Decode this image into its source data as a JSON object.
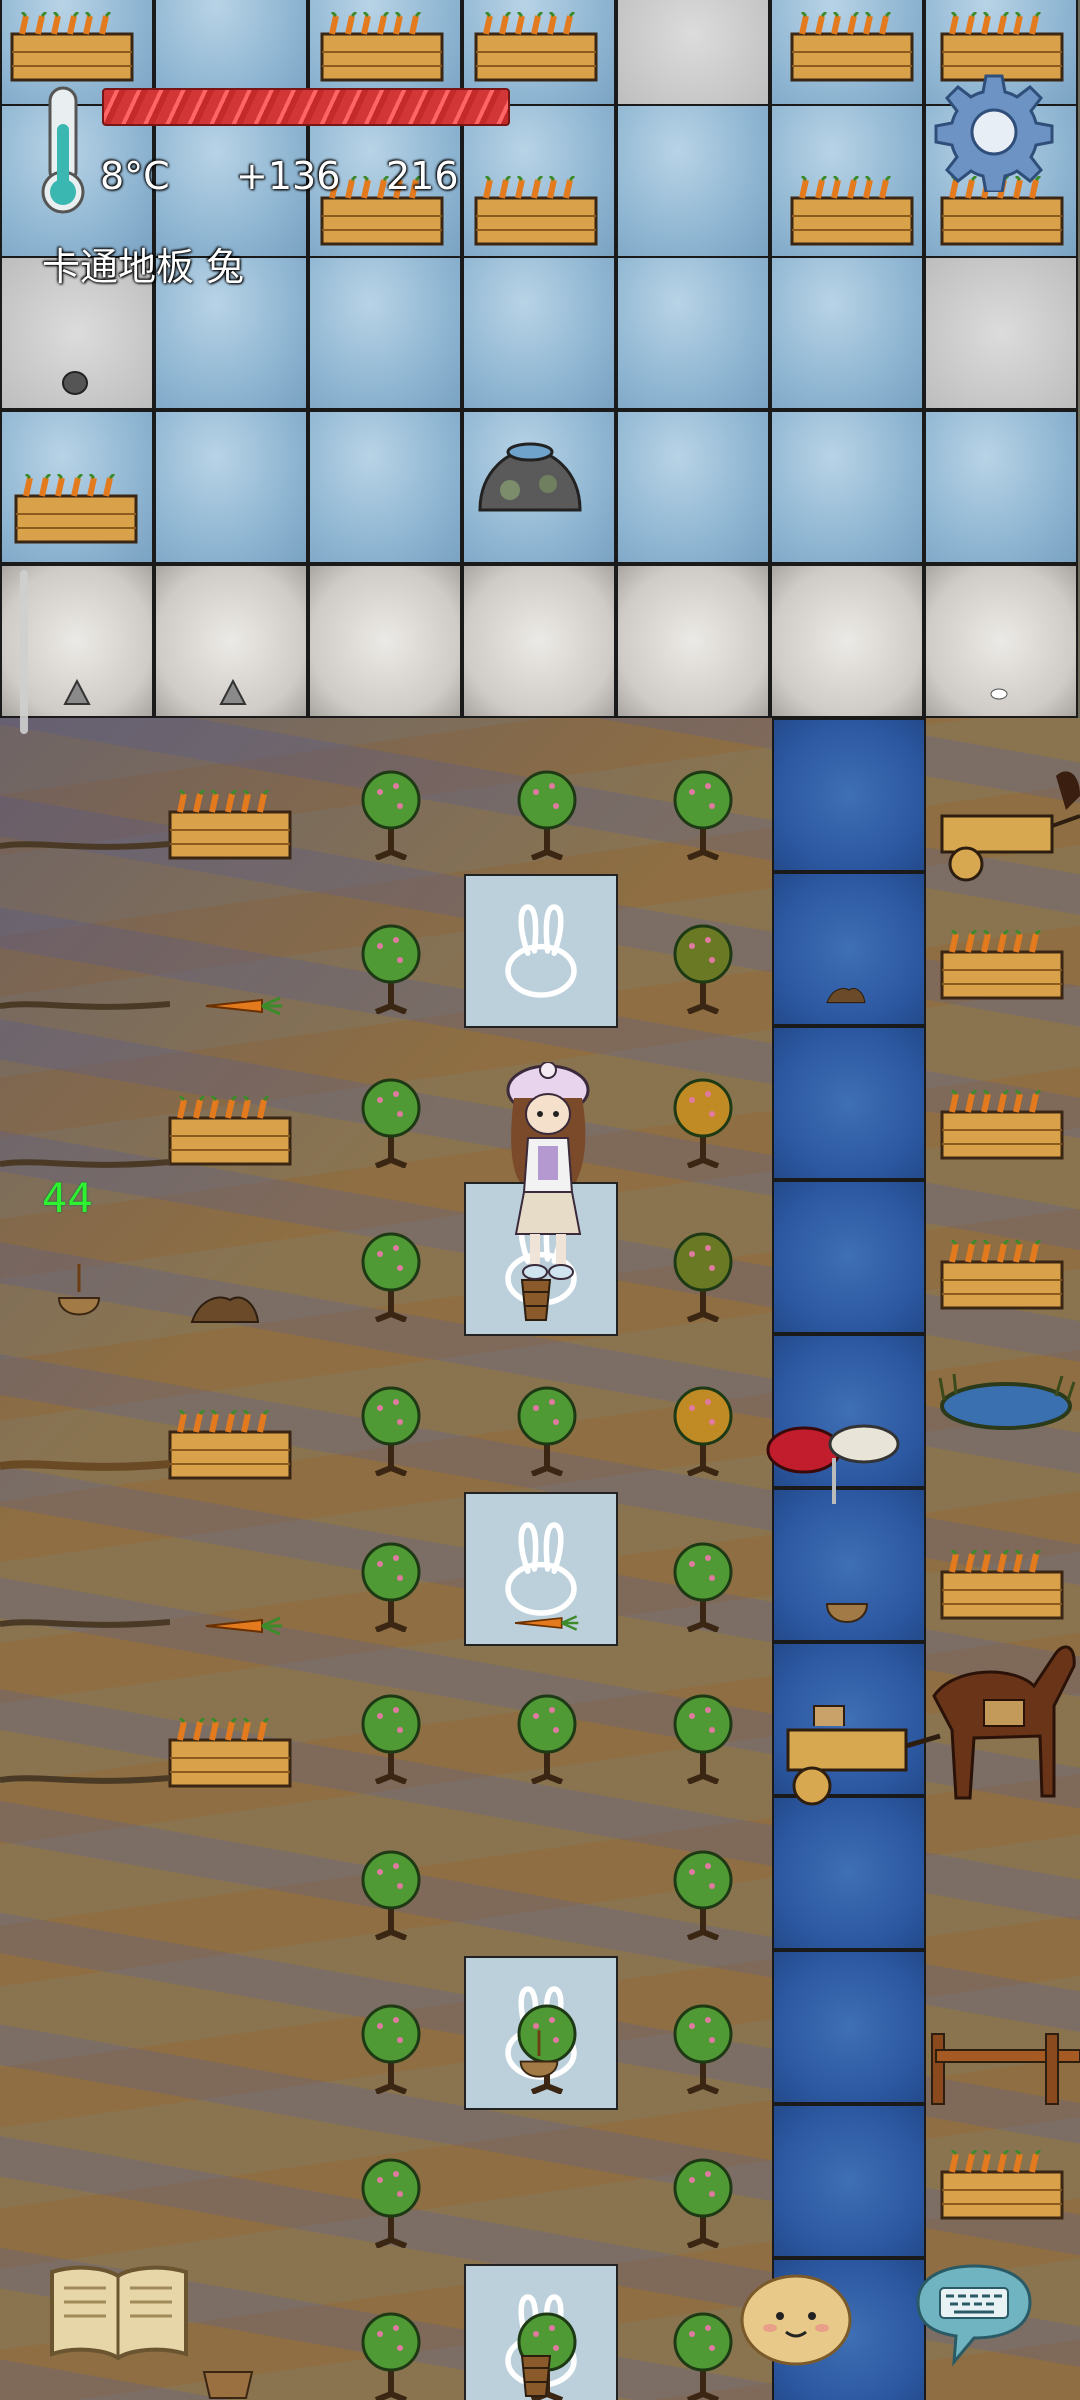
{
  "hud": {
    "temperature": "8°C",
    "food_bonus": "+136",
    "food_total": "216",
    "health_fraction": 1.0,
    "floor_label": "卡通地板 兔",
    "counter": "44"
  },
  "icons": {
    "thermometer": "thermometer-icon",
    "settings": "gear-icon",
    "book": "book-icon",
    "emote": "potato-face-icon",
    "keyboard": "keyboard-icon"
  },
  "colors": {
    "health": "#d23636",
    "counter": "#2ef230",
    "water": "#2b57a0",
    "ice": "#8fb6d2"
  }
}
